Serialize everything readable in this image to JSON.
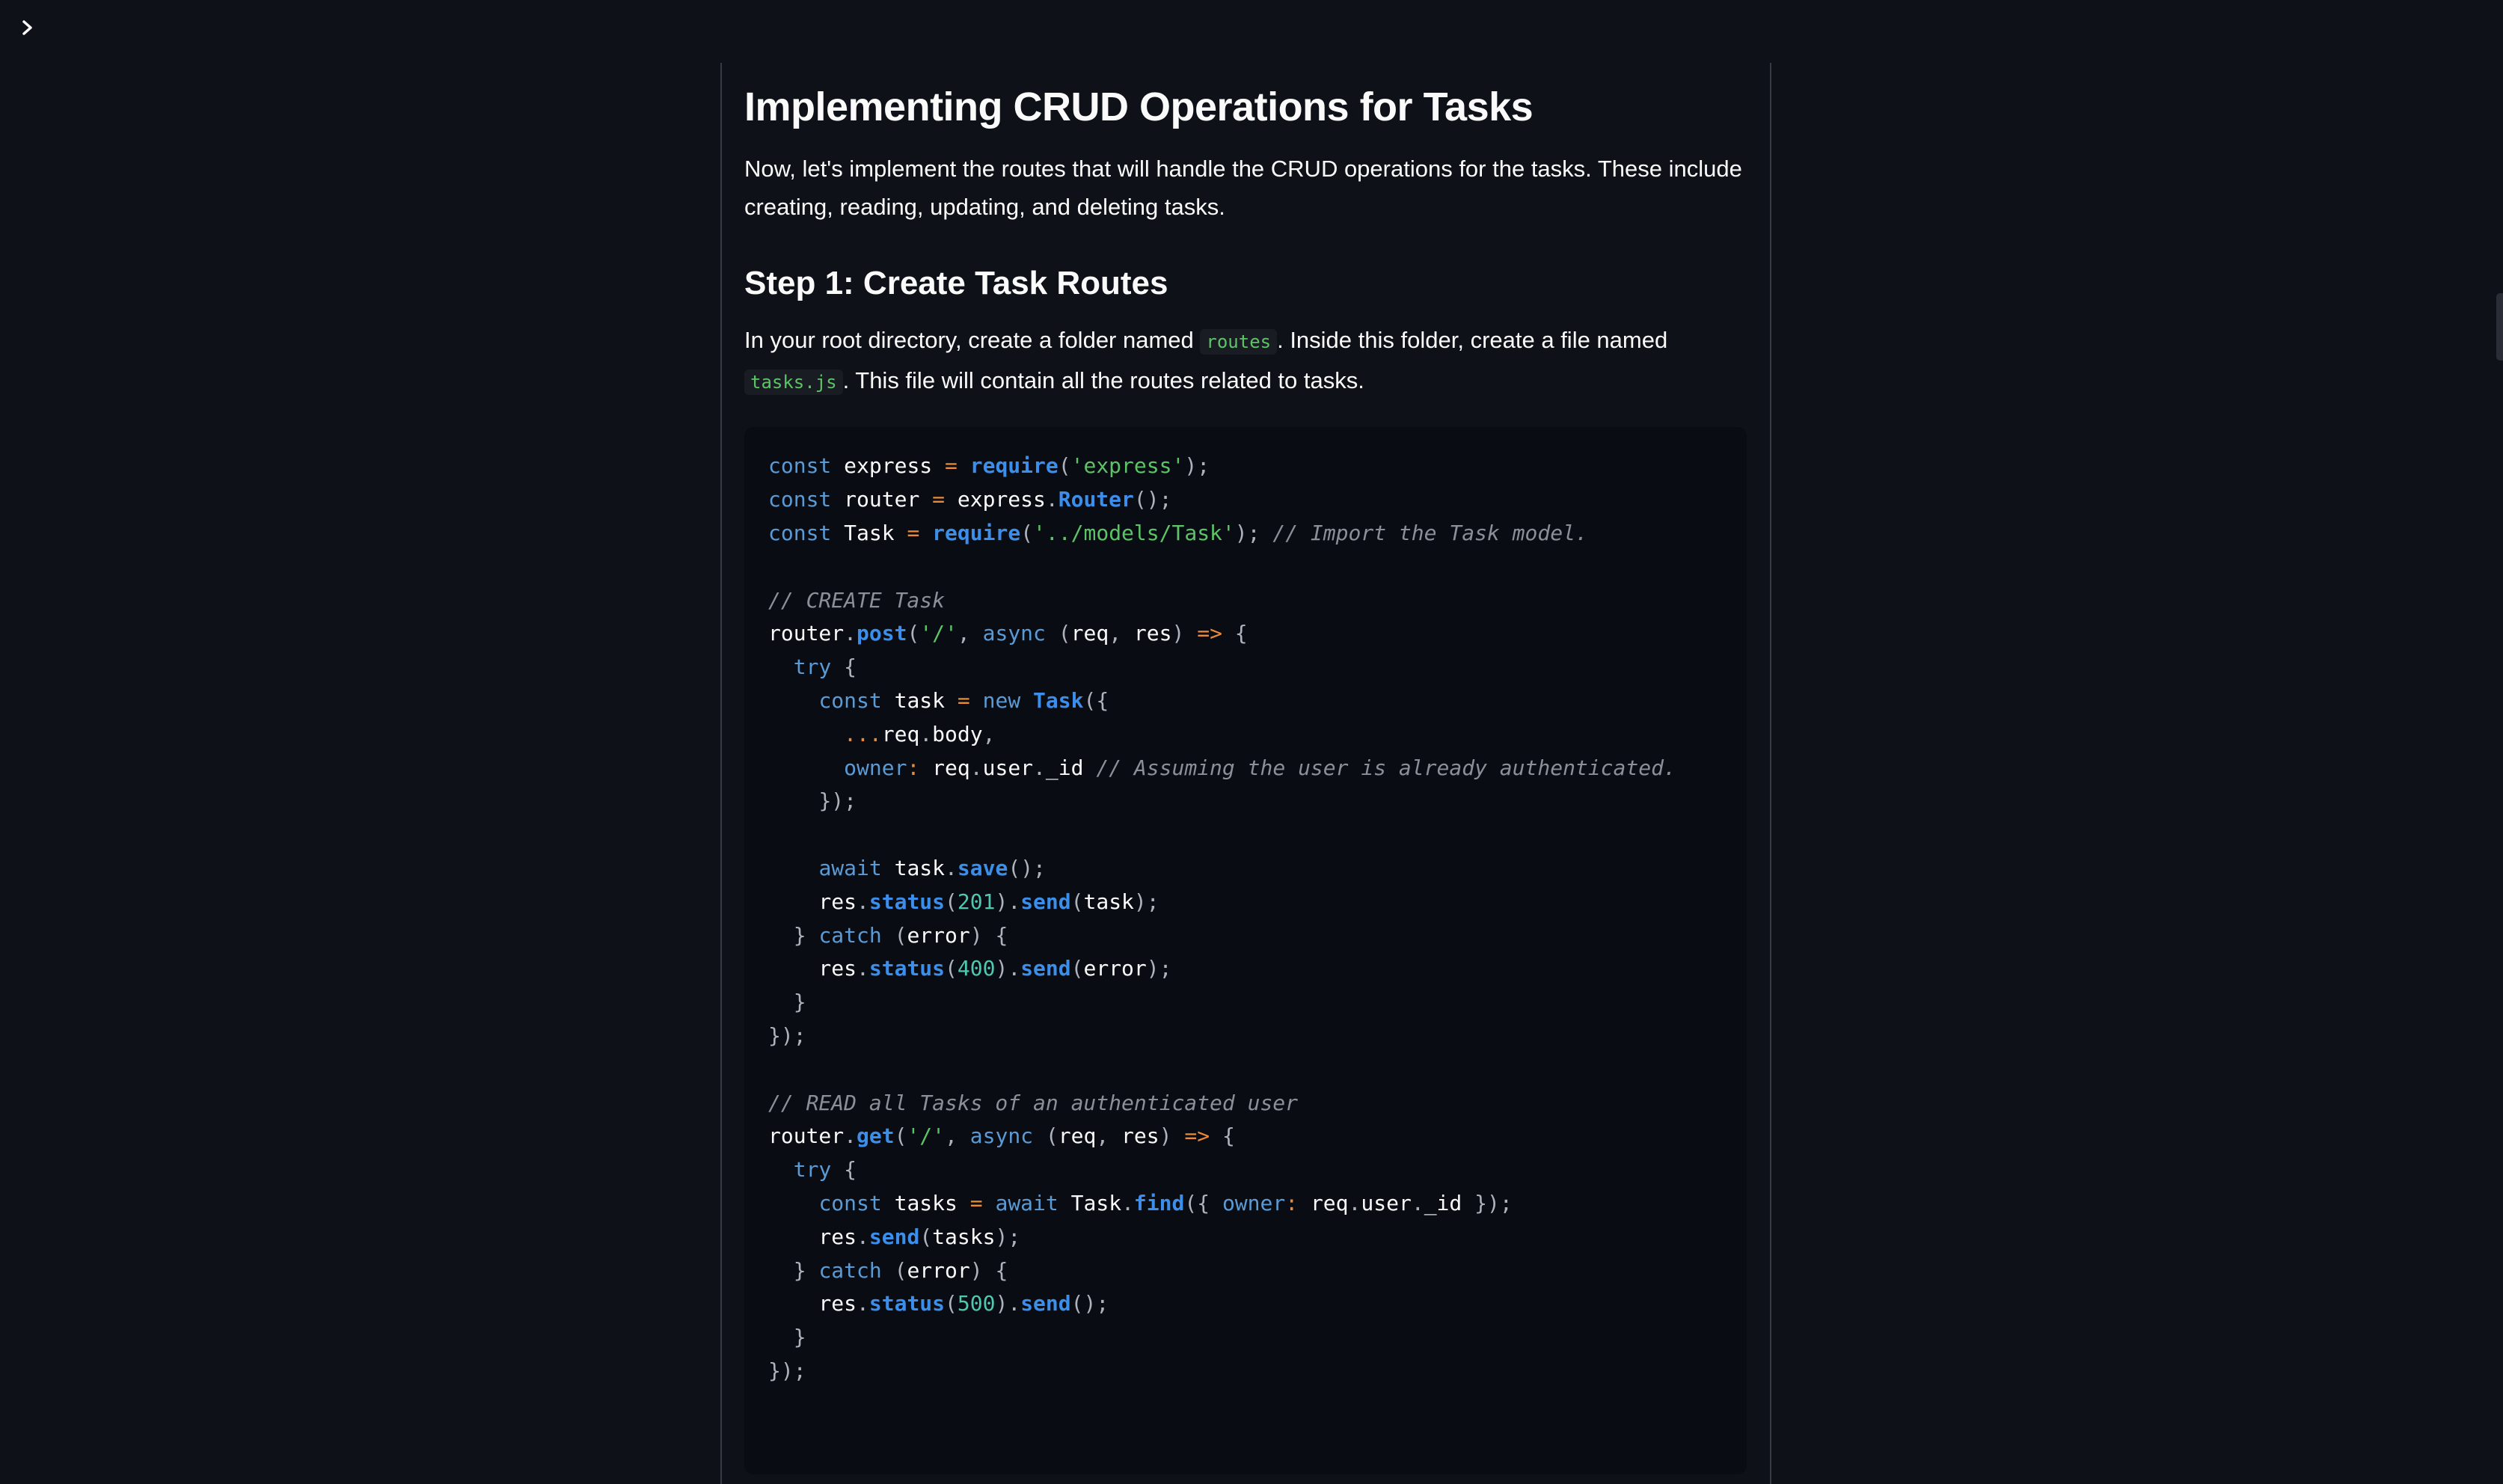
{
  "sidebar_toggle": {
    "icon": "chevron-right-icon"
  },
  "article": {
    "title": "Implementing CRUD Operations for Tasks",
    "intro": "Now, let's implement the routes that will handle the CRUD operations for the tasks. These include creating, reading, updating, and deleting tasks.",
    "step1_heading": "Step 1: Create Task Routes",
    "step1_text_a": "In your root directory, create a folder named ",
    "step1_code_a": "routes",
    "step1_text_b": ". Inside this folder, create a file named ",
    "step1_code_b": "tasks.js",
    "step1_text_c": ". This file will contain all the routes related to tasks."
  },
  "code_block": {
    "language": "javascript",
    "lines": [
      "const express = require('express');",
      "const router = express.Router();",
      "const Task = require('../models/Task'); // Import the Task model.",
      "",
      "// CREATE Task",
      "router.post('/', async (req, res) => {",
      "  try {",
      "    const task = new Task({",
      "      ...req.body,",
      "      owner: req.user._id // Assuming the user is already authenticated.",
      "    });",
      "",
      "    await task.save();",
      "    res.status(201).send(task);",
      "  } catch (error) {",
      "    res.status(400).send(error);",
      "  }",
      "});",
      "",
      "// READ all Tasks of an authenticated user",
      "router.get('/', async (req, res) => {",
      "  try {",
      "    const tasks = await Task.find({ owner: req.user._id });",
      "    res.send(tasks);",
      "  } catch (error) {",
      "    res.status(500).send();",
      "  }",
      "});"
    ]
  },
  "colors": {
    "background": "#0e1117",
    "text": "#fafafa",
    "code_bg": "#0a0c14",
    "keyword": "#5b9bd5",
    "function": "#3b8eea",
    "string": "#5cc466",
    "number": "#4ec9b0",
    "operator": "#e98a3a",
    "comment": "#8b8f98"
  }
}
